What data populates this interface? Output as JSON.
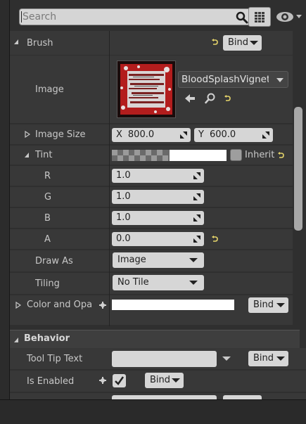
{
  "search": {
    "placeholder": "Search",
    "value": ""
  },
  "sections": {
    "brush_label": "Brush",
    "behavior_label": "Behavior"
  },
  "brush": {
    "image_label": "Image",
    "image_asset": "BloodSplashVignette",
    "image_size_label": "Image Size",
    "image_size_x_label": "X",
    "image_size_x": "800.0",
    "image_size_y_label": "Y",
    "image_size_y": "600.0",
    "tint_label": "Tint",
    "tint_inherit_label": "Inherit",
    "r_label": "R",
    "r_value": "1.0",
    "g_label": "G",
    "g_value": "1.0",
    "b_label": "B",
    "b_value": "1.0",
    "a_label": "A",
    "a_value": "0.0",
    "draw_as_label": "Draw As",
    "draw_as_value": "Image",
    "tiling_label": "Tiling",
    "tiling_value": "No Tile"
  },
  "color_and_opacity": {
    "label": "Color and Opa",
    "bind_label": "Bind"
  },
  "bind_label": "Bind",
  "behavior": {
    "tooltip_label": "Tool Tip Text",
    "tooltip_value": "",
    "is_enabled_label": "Is Enabled",
    "is_enabled": true
  },
  "icons": {
    "search": "search-icon",
    "grid": "grid-view-icon",
    "eye": "visibility-eye-icon",
    "reset": "reset-to-default-icon",
    "use_selected": "use-selected-arrow-icon",
    "browse": "browse-magnifier-icon",
    "binding": "binding-link-icon"
  },
  "colors": {
    "reset_arrow": "#e6d56a",
    "panel_bg": "#2f2f2f",
    "row_bg": "#383838",
    "field_bg": "#d6d6d6"
  }
}
